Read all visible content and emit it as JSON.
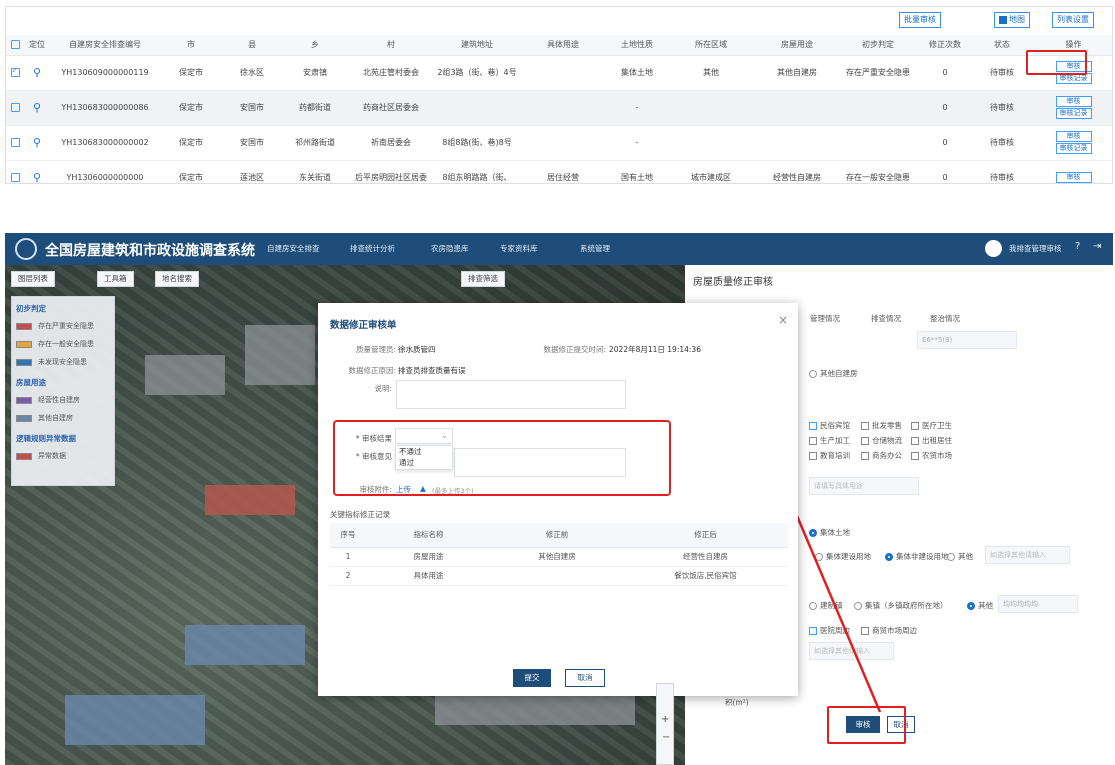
{
  "top": {
    "toolbar": {
      "batch": "批量审核",
      "map": "地图",
      "columns": "列表设置"
    },
    "headers": [
      "定位",
      "自建房安全排查编号",
      "市",
      "县",
      "乡",
      "村",
      "建筑地址",
      "具体用途",
      "土地性质",
      "所在区域",
      "房屋用途",
      "初步判定",
      "修正次数",
      "状态",
      "操作"
    ],
    "rows": [
      {
        "checked": true,
        "id": "YH130609000000119",
        "city": "保定市",
        "county": "徐水区",
        "town": "安肃镇",
        "village": "北苑庄管村委会",
        "address": "2组3路（街、巷）4号",
        "use_detail": "",
        "land": "集体土地",
        "region": "其他",
        "house_use": "其他自建房",
        "judge": "存在严重安全隐患",
        "fixes": "0",
        "status": "待审核",
        "op1": "审核",
        "op2": "审核记录"
      },
      {
        "checked": false,
        "id": "YH130683000000086",
        "city": "保定市",
        "county": "安国市",
        "town": "药都街道",
        "village": "药商社区居委会",
        "address": "",
        "use_detail": "",
        "land": "-",
        "region": "",
        "house_use": "",
        "judge": "",
        "fixes": "0",
        "status": "待审核",
        "op1": "审核",
        "op2": "审核记录"
      },
      {
        "checked": false,
        "id": "YH130683000000002",
        "city": "保定市",
        "county": "安国市",
        "town": "祁州路街道",
        "village": "祈南居委会",
        "address": "8组8路(街、巷)8号",
        "use_detail": "",
        "land": "-",
        "region": "",
        "house_use": "",
        "judge": "",
        "fixes": "0",
        "status": "待审核",
        "op1": "审核",
        "op2": "审核记录"
      },
      {
        "checked": false,
        "id": "YH1306000000000",
        "city": "保定市",
        "county": "莲池区",
        "town": "东关街道",
        "village": "后平房明园社区居委",
        "address": "8组东明路路（街、",
        "use_detail": "居住经营",
        "land": "国有土地",
        "region": "城市建成区",
        "house_use": "经营性自建房",
        "judge": "存在一般安全隐患",
        "fixes": "0",
        "status": "待审核",
        "op1": "审核",
        "op2": ""
      }
    ]
  },
  "app": {
    "title": "全国房屋建筑和市政设施调查系统",
    "menu": [
      "自建房安全排查",
      "排查统计分析",
      "农房隐患库",
      "专家资料库",
      "系统管理"
    ],
    "user": "我排查管理审核",
    "map_tools": [
      "图层列表",
      "工具箱",
      "地名搜索",
      "排查筛选"
    ],
    "legend": {
      "h1": "初步判定",
      "items1": [
        "存在严重安全隐患",
        "存在一般安全隐患",
        "未发现安全隐患"
      ],
      "h2": "房屋用途",
      "items2": [
        "经营性自建房",
        "其他自建房"
      ],
      "h3": "逻辑规则异常数据",
      "items3": [
        "异常数据"
      ]
    },
    "colors": {
      "severe": "#c0504d",
      "general": "#e6a23c",
      "none": "#2e75b6",
      "business": "#7b5ea7",
      "other": "#6b86a6",
      "abnormal": "#c0504d"
    },
    "right": {
      "title": "房屋质量修正审核",
      "tabs": [
        "管理情况",
        "排查情况",
        "整治情况"
      ],
      "code": "E6**5(8)",
      "other_house": "其他自建房",
      "uses": [
        "民俗宾馆",
        "批发零售",
        "医疗卫生",
        "生产加工",
        "仓储物流",
        "出租居住",
        "教育培训",
        "商务办公",
        "农贸市场"
      ],
      "use_placeholder": "请填写具体用途",
      "land_collective": "集体土地",
      "land_row": [
        "集体建设用地",
        "集体非建设用地",
        "其他"
      ],
      "land_placeholder": "如选择其他请输入",
      "region_row": [
        "建制镇",
        "集镇（乡镇政府所在地）",
        "其他"
      ],
      "region_other": "均均均均均",
      "near": [
        "医院周边",
        "商贸市场周边"
      ],
      "near_placeholder": "如选择其他请输入",
      "area_unit": "积(m²)",
      "submit": "审核",
      "cancel": "取消"
    }
  },
  "modal": {
    "title": "数据修正审核单",
    "close": "×",
    "manager_label": "质量管理员:",
    "manager": "徐水质管四",
    "time_label": "数据修正提交时间:",
    "time": "2022年8月11日 19:14:36",
    "reason_label": "数据修正原因:",
    "reason": "排查员排查质量有误",
    "desc_label": "说明:",
    "result_label": "* 审核结果",
    "opinion_label": "* 审核意见",
    "options": [
      "不通过",
      "通过"
    ],
    "attach_label": "审核附件:",
    "upload": "上传",
    "upload_hint": "(最多上传3个)",
    "section": "关键指标修正记录",
    "table_headers": [
      "序号",
      "指标名称",
      "修正前",
      "修正后"
    ],
    "table_rows": [
      [
        "1",
        "房屋用途",
        "其他自建房",
        "经营性自建房"
      ],
      [
        "2",
        "具体用途",
        "",
        "餐饮饭店,民俗宾馆"
      ]
    ],
    "submit": "提交",
    "cancel": "取消"
  }
}
